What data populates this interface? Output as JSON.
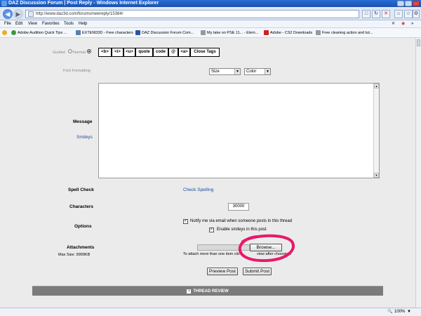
{
  "window": {
    "title": "DAZ Discussion Forum | Post Reply - Windows Internet Explorer"
  },
  "address": {
    "url": "http://www.daz3d.com/forums/newreply/15384/"
  },
  "menu": {
    "items": [
      "File",
      "Edit",
      "View",
      "Favorites",
      "Tools",
      "Help"
    ]
  },
  "favorites": {
    "items": [
      {
        "label": "Adobe Audition Quick Tips ...",
        "icon": "globe-icon",
        "color": "#3a9a3a"
      },
      {
        "label": "EXTEND3D - Free characters",
        "icon": "page-icon",
        "color": "#5a7fb0"
      },
      {
        "label": "DAZ Discussion Forum  Com...",
        "icon": "daz-icon",
        "color": "#2a55a0"
      },
      {
        "label": "My take on PSE 11... - Elem...",
        "icon": "page-icon",
        "color": "#777777"
      },
      {
        "label": "Adobe - CS2 Downloads",
        "icon": "adobe-icon",
        "color": "#d02020"
      },
      {
        "label": "Free cleaning action and tut...",
        "icon": "page-icon",
        "color": "#777777"
      }
    ]
  },
  "form": {
    "mode": {
      "guided": "Guided",
      "normal": "Normal"
    },
    "format_buttons": [
      "<b>",
      "<i>",
      "<u>",
      "quote",
      "code",
      "@",
      "<a>",
      "Close Tags"
    ],
    "font_formatting_label": "Font Formatting",
    "size_select": "Size",
    "color_select": "Color",
    "message_label": "Message",
    "smileys_link": "Smileys",
    "spell_check_label": "Spell Check",
    "check_spelling_link": "Check Spelling",
    "characters_label": "Characters",
    "characters_value": "30000",
    "options_label": "Options",
    "notify_option": "Notify me via email when someone posts in this thread",
    "smilies_option": "Enable smileys in this post",
    "attachments_label": "Attachments",
    "max_size": "Max Size: 9999KB",
    "browse_button": "Browse...",
    "attach_hint_left": "To attach more than one item clic",
    "attach_hint_right": "view after choosing",
    "attach_hint_end": "le",
    "preview_button": "Preview Post",
    "submit_button": "Submit Post",
    "thread_review": "THREAD REVIEW"
  },
  "status": {
    "zoom": "100%"
  },
  "colors": {
    "annotation_circle": "#e8196b"
  }
}
